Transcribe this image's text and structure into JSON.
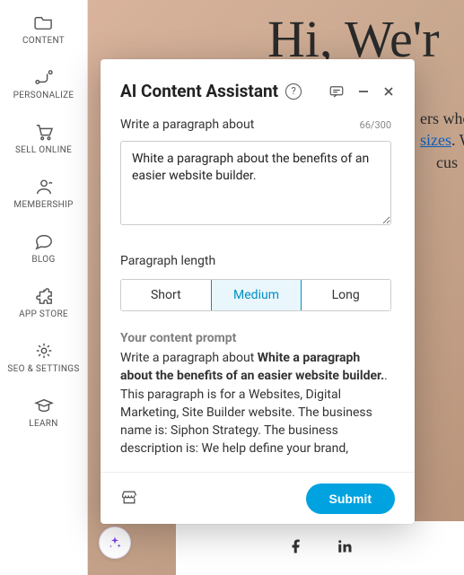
{
  "sidebar": {
    "items": [
      {
        "label": "CONTENT",
        "icon": "folder-icon"
      },
      {
        "label": "PERSONALIZE",
        "icon": "route-icon"
      },
      {
        "label": "SELL ONLINE",
        "icon": "cart-icon"
      },
      {
        "label": "MEMBERSHIP",
        "icon": "person-icon"
      },
      {
        "label": "BLOG",
        "icon": "chat-icon"
      },
      {
        "label": "APP STORE",
        "icon": "puzzle-icon"
      },
      {
        "label": "SEO & SETTINGS",
        "icon": "gear-icon"
      },
      {
        "label": "LEARN",
        "icon": "grad-cap-icon"
      }
    ]
  },
  "hero": {
    "title": "Hi, We'r",
    "para_line1": "ers who",
    "para_line2_a": "sizes",
    "para_line2_b": ". W",
    "para_line3": "cus"
  },
  "modal": {
    "title": "AI Content Assistant",
    "prompt_label": "Write a paragraph about",
    "char_count": "66/300",
    "textarea_value": "White a paragraph about the benefits of an easier website builder.",
    "length_label": "Paragraph length",
    "length_options": [
      "Short",
      "Medium",
      "Long"
    ],
    "length_selected": 1,
    "content_prompt_head": "Your content prompt",
    "content_prompt_lead": "Write a paragraph about ",
    "content_prompt_bold": "White a paragraph about the benefits of an easier website builder.",
    "content_prompt_tail": ". This paragraph is for a Websites, Digital Marketing, Site Builder website. The business name is: Siphon Strategy. The business description is: We help define your brand,",
    "submit_label": "Submit"
  }
}
